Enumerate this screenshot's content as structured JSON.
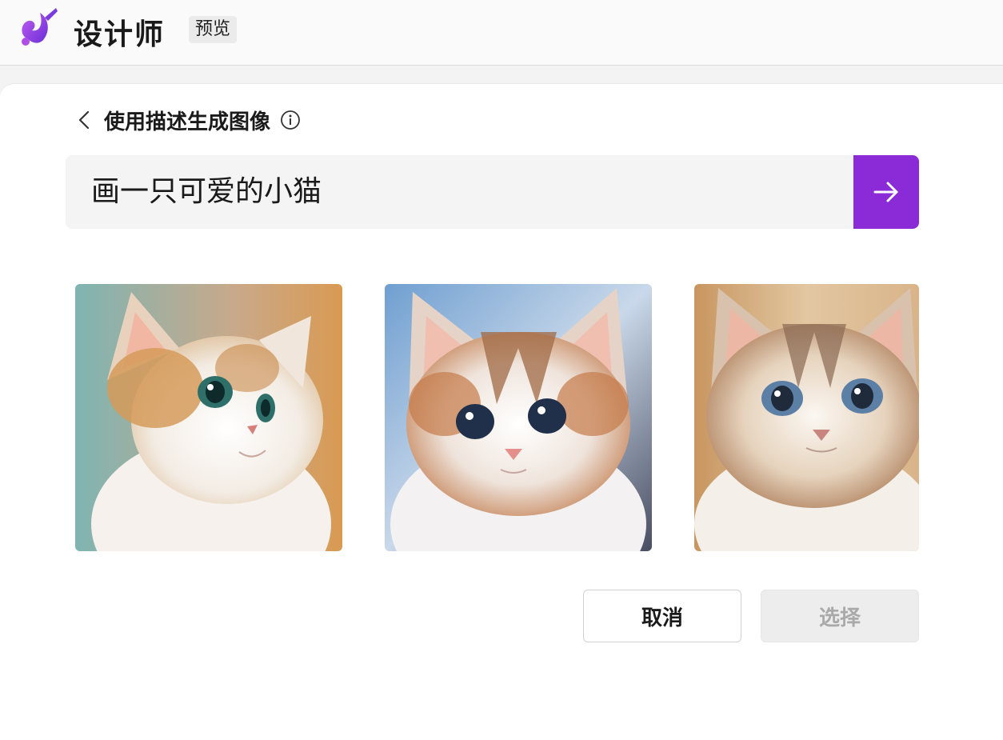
{
  "app": {
    "title": "设计师",
    "badge": "预览"
  },
  "section": {
    "title": "使用描述生成图像"
  },
  "prompt": {
    "value": "画一只可爱的小猫"
  },
  "images": [
    {
      "subject": "kitten-looking-right"
    },
    {
      "subject": "kitten-facing-front"
    },
    {
      "subject": "kitten-wide-eyes"
    }
  ],
  "actions": {
    "cancel_label": "取消",
    "select_label": "选择"
  },
  "colors": {
    "accent": "#8b2bd8",
    "logo_gradient_start": "#c05cf0",
    "logo_gradient_end": "#6a2fd8"
  },
  "icons": {
    "logo": "designer-logo-icon",
    "back": "chevron-left-icon",
    "info": "info-icon",
    "submit": "arrow-right-icon"
  }
}
